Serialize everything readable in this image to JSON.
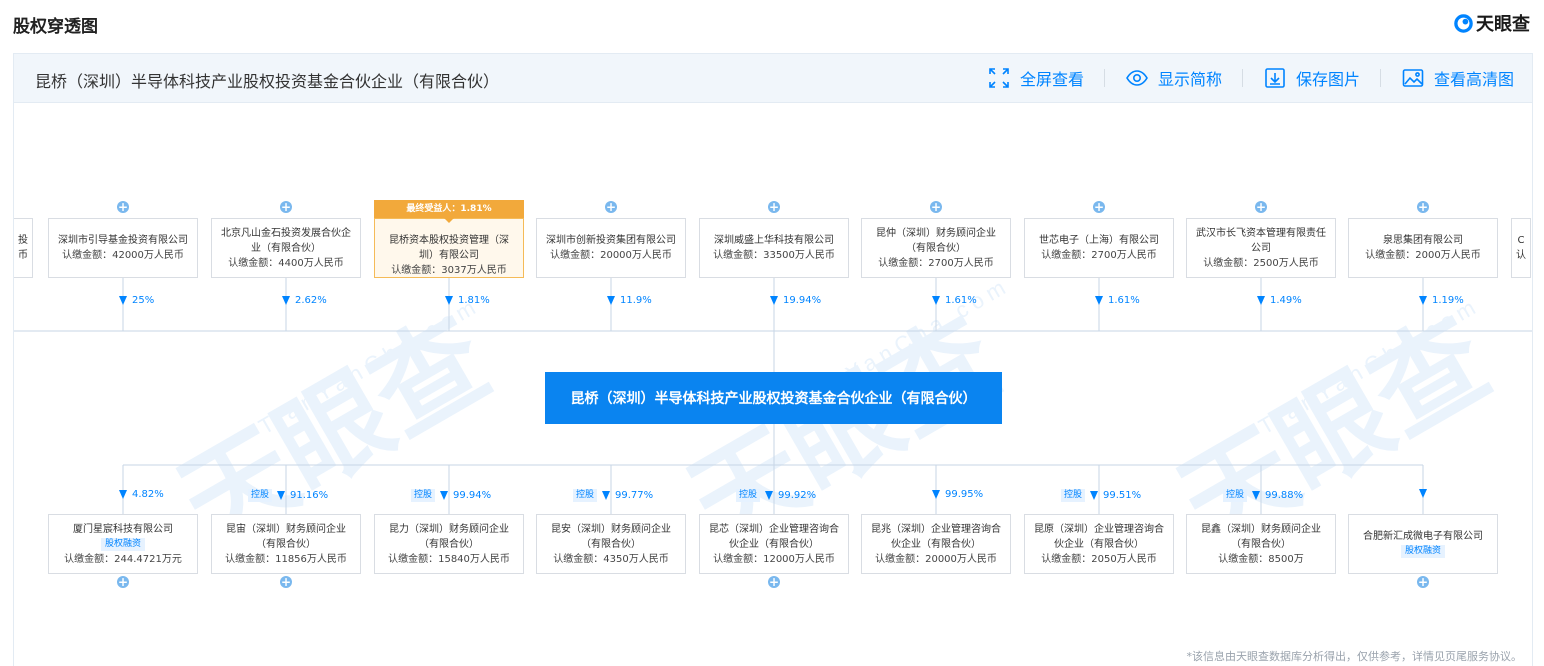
{
  "page": {
    "title": "股权穿透图"
  },
  "brand": {
    "name": "天眼查",
    "accent": "#0084ff"
  },
  "header": {
    "entity_name": "昆桥（深圳）半导体科技产业股权投资基金合伙企业（有限合伙）",
    "actions": [
      {
        "label": "全屏查看",
        "icon": "fullscreen-icon"
      },
      {
        "label": "显示简称",
        "icon": "eye-icon"
      },
      {
        "label": "保存图片",
        "icon": "download-icon"
      },
      {
        "label": "查看高清图",
        "icon": "image-icon"
      }
    ]
  },
  "watermark": {
    "text": "天眼查",
    "sub": "TianYanCha.com"
  },
  "center": {
    "name": "昆桥（深圳）半导体科技产业股权投资基金合伙企业（有限合伙）"
  },
  "shareholders": [
    {
      "name": "深圳市引导基金投资有限公司",
      "amount": "认缴金额：42000万人民币",
      "pct": "25%"
    },
    {
      "name": "北京凡山金石投资发展合伙企业（有限合伙）",
      "amount": "认缴金额：4400万人民币",
      "pct": "2.62%"
    },
    {
      "name": "昆桥资本股权投资管理（深圳）有限公司",
      "amount": "认缴金额：3037万人民币",
      "pct": "1.81%",
      "tag": "最终受益人：1.81%"
    },
    {
      "name": "深圳市创新投资集团有限公司",
      "amount": "认缴金额：20000万人民币",
      "pct": "11.9%"
    },
    {
      "name": "深圳威盛上华科技有限公司",
      "amount": "认缴金额：33500万人民币",
      "pct": "19.94%"
    },
    {
      "name": "昆仲（深圳）财务顾问企业（有限合伙）",
      "amount": "认缴金额：2700万人民币",
      "pct": "1.61%"
    },
    {
      "name": "世芯电子（上海）有限公司",
      "amount": "认缴金额：2700万人民币",
      "pct": "1.61%"
    },
    {
      "name": "武汉市长飞资本管理有限责任公司",
      "amount": "认缴金额：2500万人民币",
      "pct": "1.49%"
    },
    {
      "name": "泉思集团有限公司",
      "amount": "认缴金额：2000万人民币",
      "pct": "1.19%"
    }
  ],
  "investments": [
    {
      "name": "厦门星宸科技有限公司",
      "badge": "股权融资",
      "amount": "认缴金额：244.4721万元",
      "pct": "4.82%",
      "control": ""
    },
    {
      "name": "昆宙（深圳）财务顾问企业（有限合伙）",
      "badge": "",
      "amount": "认缴金额：11856万人民币",
      "pct": "91.16%",
      "control": "控股"
    },
    {
      "name": "昆力（深圳）财务顾问企业（有限合伙）",
      "badge": "",
      "amount": "认缴金额：15840万人民币",
      "pct": "99.94%",
      "control": "控股"
    },
    {
      "name": "昆安（深圳）财务顾问企业（有限合伙）",
      "badge": "",
      "amount": "认缴金额：4350万人民币",
      "pct": "99.77%",
      "control": "控股"
    },
    {
      "name": "昆芯（深圳）企业管理咨询合伙企业（有限合伙）",
      "badge": "",
      "amount": "认缴金额：12000万人民币",
      "pct": "99.92%",
      "control": "控股"
    },
    {
      "name": "昆兆（深圳）企业管理咨询合伙企业（有限合伙）",
      "badge": "",
      "amount": "认缴金额：20000万人民币",
      "pct": "99.95%",
      "control": ""
    },
    {
      "name": "昆原（深圳）企业管理咨询合伙企业（有限合伙）",
      "badge": "",
      "amount": "认缴金额：2050万人民币",
      "pct": "99.51%",
      "control": "控股"
    },
    {
      "name": "昆鑫（深圳）财务顾问企业（有限合伙）",
      "badge": "",
      "amount": "认缴金额：8500万",
      "pct": "99.88%",
      "control": "控股"
    },
    {
      "name": "合肥新汇成微电子有限公司",
      "badge": "股权融资",
      "amount": "",
      "pct": "",
      "control": ""
    }
  ],
  "partial_left": {
    "top": "投",
    "bottom": "币"
  },
  "partial_right": {
    "top": "C",
    "bottom": "认"
  },
  "disclaimer": "*该信息由天眼查数据库分析得出，仅供参考，详情见页尾服务协议。"
}
